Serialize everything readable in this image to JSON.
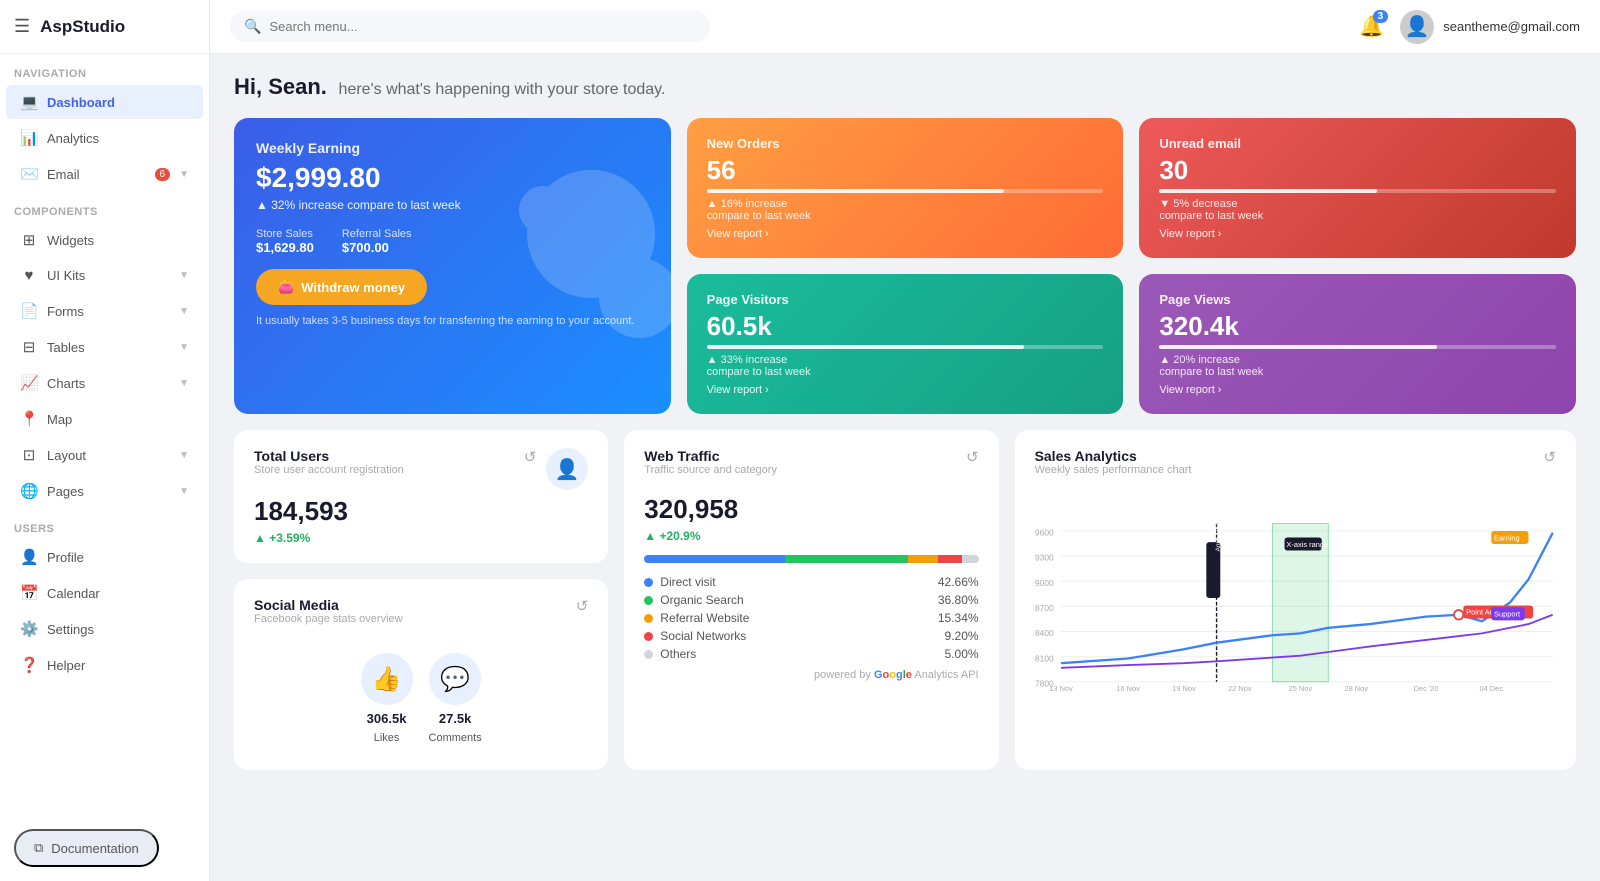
{
  "app": {
    "brand": "AspStudio",
    "search_placeholder": "Search menu...",
    "notification_count": "3",
    "user_email": "seantheme@gmail.com"
  },
  "sidebar": {
    "nav_label": "Navigation",
    "components_label": "Components",
    "users_label": "Users",
    "items_nav": [
      {
        "id": "dashboard",
        "label": "Dashboard",
        "icon": "💻",
        "active": true
      },
      {
        "id": "analytics",
        "label": "Analytics",
        "icon": "📊",
        "active": false
      },
      {
        "id": "email",
        "label": "Email",
        "icon": "✉️",
        "active": false,
        "badge": "6",
        "arrow": true
      }
    ],
    "items_components": [
      {
        "id": "widgets",
        "label": "Widgets",
        "icon": "⊞",
        "active": false
      },
      {
        "id": "ui-kits",
        "label": "UI Kits",
        "icon": "♥",
        "active": false,
        "arrow": true
      },
      {
        "id": "forms",
        "label": "Forms",
        "icon": "📄",
        "active": false,
        "arrow": true
      },
      {
        "id": "tables",
        "label": "Tables",
        "icon": "⊟",
        "active": false,
        "arrow": true
      },
      {
        "id": "charts",
        "label": "Charts",
        "icon": "📈",
        "active": false,
        "arrow": true
      },
      {
        "id": "map",
        "label": "Map",
        "icon": "📍",
        "active": false
      },
      {
        "id": "layout",
        "label": "Layout",
        "icon": "⊡",
        "active": false,
        "arrow": true
      },
      {
        "id": "pages",
        "label": "Pages",
        "icon": "🌐",
        "active": false,
        "arrow": true
      }
    ],
    "items_users": [
      {
        "id": "profile",
        "label": "Profile",
        "icon": "👤",
        "active": false
      },
      {
        "id": "calendar",
        "label": "Calendar",
        "icon": "📅",
        "active": false
      },
      {
        "id": "settings",
        "label": "Settings",
        "icon": "⚙️",
        "active": false
      },
      {
        "id": "helper",
        "label": "Helper",
        "icon": "❓",
        "active": false
      }
    ],
    "doc_btn_label": "Documentation",
    "doc_icon": "⧉"
  },
  "greeting": {
    "name": "Hi, Sean.",
    "subtitle": "here's what's happening with your store today."
  },
  "weekly": {
    "title": "Weekly Earning",
    "amount": "$2,999.80",
    "change": "▲ 32% increase compare to last week",
    "store_sales_label": "Store Sales",
    "store_sales_value": "$1,629.80",
    "referral_sales_label": "Referral Sales",
    "referral_sales_value": "$700.00",
    "btn_label": "Withdraw money",
    "note": "It usually takes 3-5 business days for transferring the earning to your account."
  },
  "stat_cards": [
    {
      "id": "new-orders",
      "title": "New Orders",
      "value": "56",
      "bar_pct": 75,
      "change": "▲ 16% increase compare to last week",
      "link": "View report >",
      "color": "orange"
    },
    {
      "id": "unread-email",
      "title": "Unread email",
      "value": "30",
      "bar_pct": 55,
      "change": "▼ 5% decrease compare to last week",
      "link": "View report >",
      "color": "red"
    },
    {
      "id": "page-visitors",
      "title": "Page Visitors",
      "value": "60.5k",
      "bar_pct": 80,
      "change": "▲ 33% increase compare to last week",
      "link": "View report >",
      "color": "teal"
    },
    {
      "id": "page-views",
      "title": "Page Views",
      "value": "320.4k",
      "bar_pct": 70,
      "change": "▲ 20% increase compare to last week",
      "link": "View report >",
      "color": "purple"
    }
  ],
  "total_users": {
    "title": "Total Users",
    "sub": "Store user account registration",
    "value": "184,593",
    "change": "+3.59%"
  },
  "web_traffic": {
    "title": "Web Traffic",
    "sub": "Traffic source and category",
    "value": "320,958",
    "change": "+20.9%",
    "segments": [
      {
        "label": "Direct visit",
        "pct": 42.66,
        "color": "#3b82f6",
        "bar_pct": 42
      },
      {
        "label": "Organic Search",
        "pct": 36.8,
        "color": "#22c55e",
        "bar_pct": 37
      },
      {
        "label": "Referral Website",
        "pct": 15.34,
        "color": "#f59e0b",
        "bar_pct": 15
      },
      {
        "label": "Social Networks",
        "pct": 9.2,
        "color": "#ef4444",
        "bar_pct": 9
      },
      {
        "label": "Others",
        "pct": 5.0,
        "color": "#d1d5db",
        "bar_pct": 5
      }
    ],
    "ga_label": "powered by Google Analytics API"
  },
  "social_media": {
    "title": "Social Media",
    "sub": "Facebook page stats overview",
    "items": [
      {
        "id": "likes",
        "icon": "👍",
        "count": "306.5k",
        "label": "Likes",
        "color": "#4361ee"
      },
      {
        "id": "comments",
        "icon": "💬",
        "count": "27.5k",
        "label": "Comments",
        "color": "#4361ee"
      }
    ]
  },
  "sales_analytics": {
    "title": "Sales Analytics",
    "sub": "Weekly sales performance chart",
    "x_labels": [
      "13 Nov",
      "16 Nov",
      "19 Nov",
      "22 Nov",
      "25 Nov",
      "28 Nov",
      "Dec '20",
      "04 Dec"
    ],
    "y_labels": [
      "7800",
      "8100",
      "8400",
      "8700",
      "9000",
      "9300",
      "9600"
    ],
    "series": [
      {
        "id": "earning",
        "label": "Earning",
        "color": "#3b82f6"
      },
      {
        "id": "support",
        "label": "Support",
        "color": "#7c3aed"
      }
    ],
    "annotations": [
      {
        "label": "Anno. Test",
        "type": "vertical"
      },
      {
        "label": "X-axis range",
        "type": "range"
      },
      {
        "label": "Point Annotation",
        "type": "point"
      }
    ]
  }
}
